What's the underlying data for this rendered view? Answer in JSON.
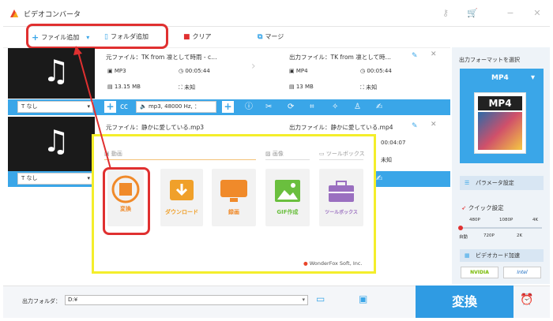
{
  "app": {
    "title": "ビデオコンバータ"
  },
  "toolbar": {
    "add_file": "ファイル追加",
    "add_folder": "フォルダ追加",
    "clear": "クリア",
    "merge": "マージ"
  },
  "files": [
    {
      "source_name": "元ファイル：TK from 凛として時雨 - c…",
      "source_format": "MP3",
      "source_duration": "00:05:44",
      "source_size": "13.15 MB",
      "source_res": "未知",
      "output_name": "出力ファイル：TK from 凛として時…",
      "output_format": "MP4",
      "output_duration": "00:05:44",
      "output_size": "13 MB",
      "output_res": "未知",
      "subtitle": "なし",
      "audio": "mp3, 48000 Hz, ："
    },
    {
      "source_name": "元ファイル：静かに愛している.mp3",
      "output_name": "出力ファイル：静かに愛している.mp4",
      "output_duration": "00:04:07",
      "output_res": "未知",
      "subtitle": "なし"
    }
  ],
  "right_panel": {
    "output_format_label": "出力フォーマットを選択",
    "format_selected": "MP4",
    "format_icon_text": "MP4",
    "params_button": "パラメータ設定",
    "quick_settings": "クイック設定",
    "quality_top": [
      "480P",
      "1080P",
      "4K"
    ],
    "quality_bottom": [
      "自動",
      "720P",
      "2K"
    ],
    "gpu_accel": "ビデオカード加速",
    "nvidia": "NVIDIA",
    "intel": "Intel"
  },
  "bottom": {
    "output_folder_label": "出力フォルダ：",
    "output_folder_value": "D:¥",
    "convert_button": "変換"
  },
  "overlay": {
    "categories": [
      "動画",
      "画像",
      "ツールボックス"
    ],
    "tiles": [
      {
        "label": "変換",
        "color": "#f08a2a"
      },
      {
        "label": "ダウンロード",
        "color": "#f0a02a"
      },
      {
        "label": "録画",
        "color": "#f08a2a"
      },
      {
        "label": "GIF作成",
        "color": "#6abf3e"
      },
      {
        "label": "ツールボックス",
        "color": "#9a6fc0"
      }
    ],
    "brand": "WonderFox Soft, Inc."
  }
}
